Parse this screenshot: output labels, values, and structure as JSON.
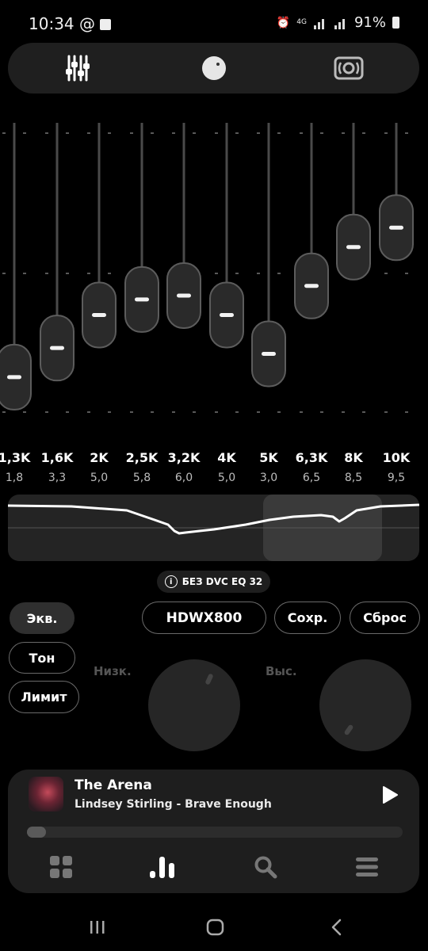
{
  "status_bar": {
    "time": "10:34",
    "network": "4G",
    "battery": "91%"
  },
  "top_tabs": [
    {
      "icon": "equalizer-sliders-icon",
      "active": true
    },
    {
      "icon": "dial-knob-icon",
      "active": false
    },
    {
      "icon": "surround-speaker-icon",
      "active": false
    }
  ],
  "equalizer": {
    "bands": [
      {
        "freq": "1,3K",
        "gain_label": "1,8",
        "level": 1.8
      },
      {
        "freq": "1,6K",
        "gain_label": "3,3",
        "level": 3.3
      },
      {
        "freq": "2K",
        "gain_label": "5,0",
        "level": 5.0
      },
      {
        "freq": "2,5K",
        "gain_label": "5,8",
        "level": 5.8
      },
      {
        "freq": "3,2K",
        "gain_label": "6,0",
        "level": 6.0
      },
      {
        "freq": "4K",
        "gain_label": "5,0",
        "level": 5.0
      },
      {
        "freq": "5K",
        "gain_label": "3,0",
        "level": 3.0
      },
      {
        "freq": "6,3K",
        "gain_label": "6,5",
        "level": 6.5
      },
      {
        "freq": "8K",
        "gain_label": "8,5",
        "level": 8.5
      },
      {
        "freq": "10K",
        "gain_label": "9,5",
        "level": 9.5
      }
    ]
  },
  "dvc_badge": {
    "label": "БЕЗ DVC EQ 32"
  },
  "mode_buttons": {
    "eq": "Экв.",
    "tone": "Тон",
    "limit": "Лимит"
  },
  "preset": {
    "name": "HDWX800",
    "save": "Сохр.",
    "reset": "Сброс"
  },
  "tone_knobs": {
    "low_label": "Низк.",
    "high_label": "Выс."
  },
  "player": {
    "title": "The Arena",
    "artist_album": "Lindsey Stirling - Brave Enough",
    "progress": 0.05
  },
  "bottom_nav": [
    {
      "icon": "grid-icon"
    },
    {
      "icon": "equalizer-bars-icon"
    },
    {
      "icon": "search-icon"
    },
    {
      "icon": "menu-icon"
    }
  ],
  "system_nav": [
    "recents-icon",
    "home-icon",
    "back-icon"
  ],
  "colors": {
    "background": "#000000",
    "panel": "#1f1f1f",
    "green": "#2fdc27",
    "yellow_green": "#c6f02a",
    "orange": "#f3a516"
  }
}
